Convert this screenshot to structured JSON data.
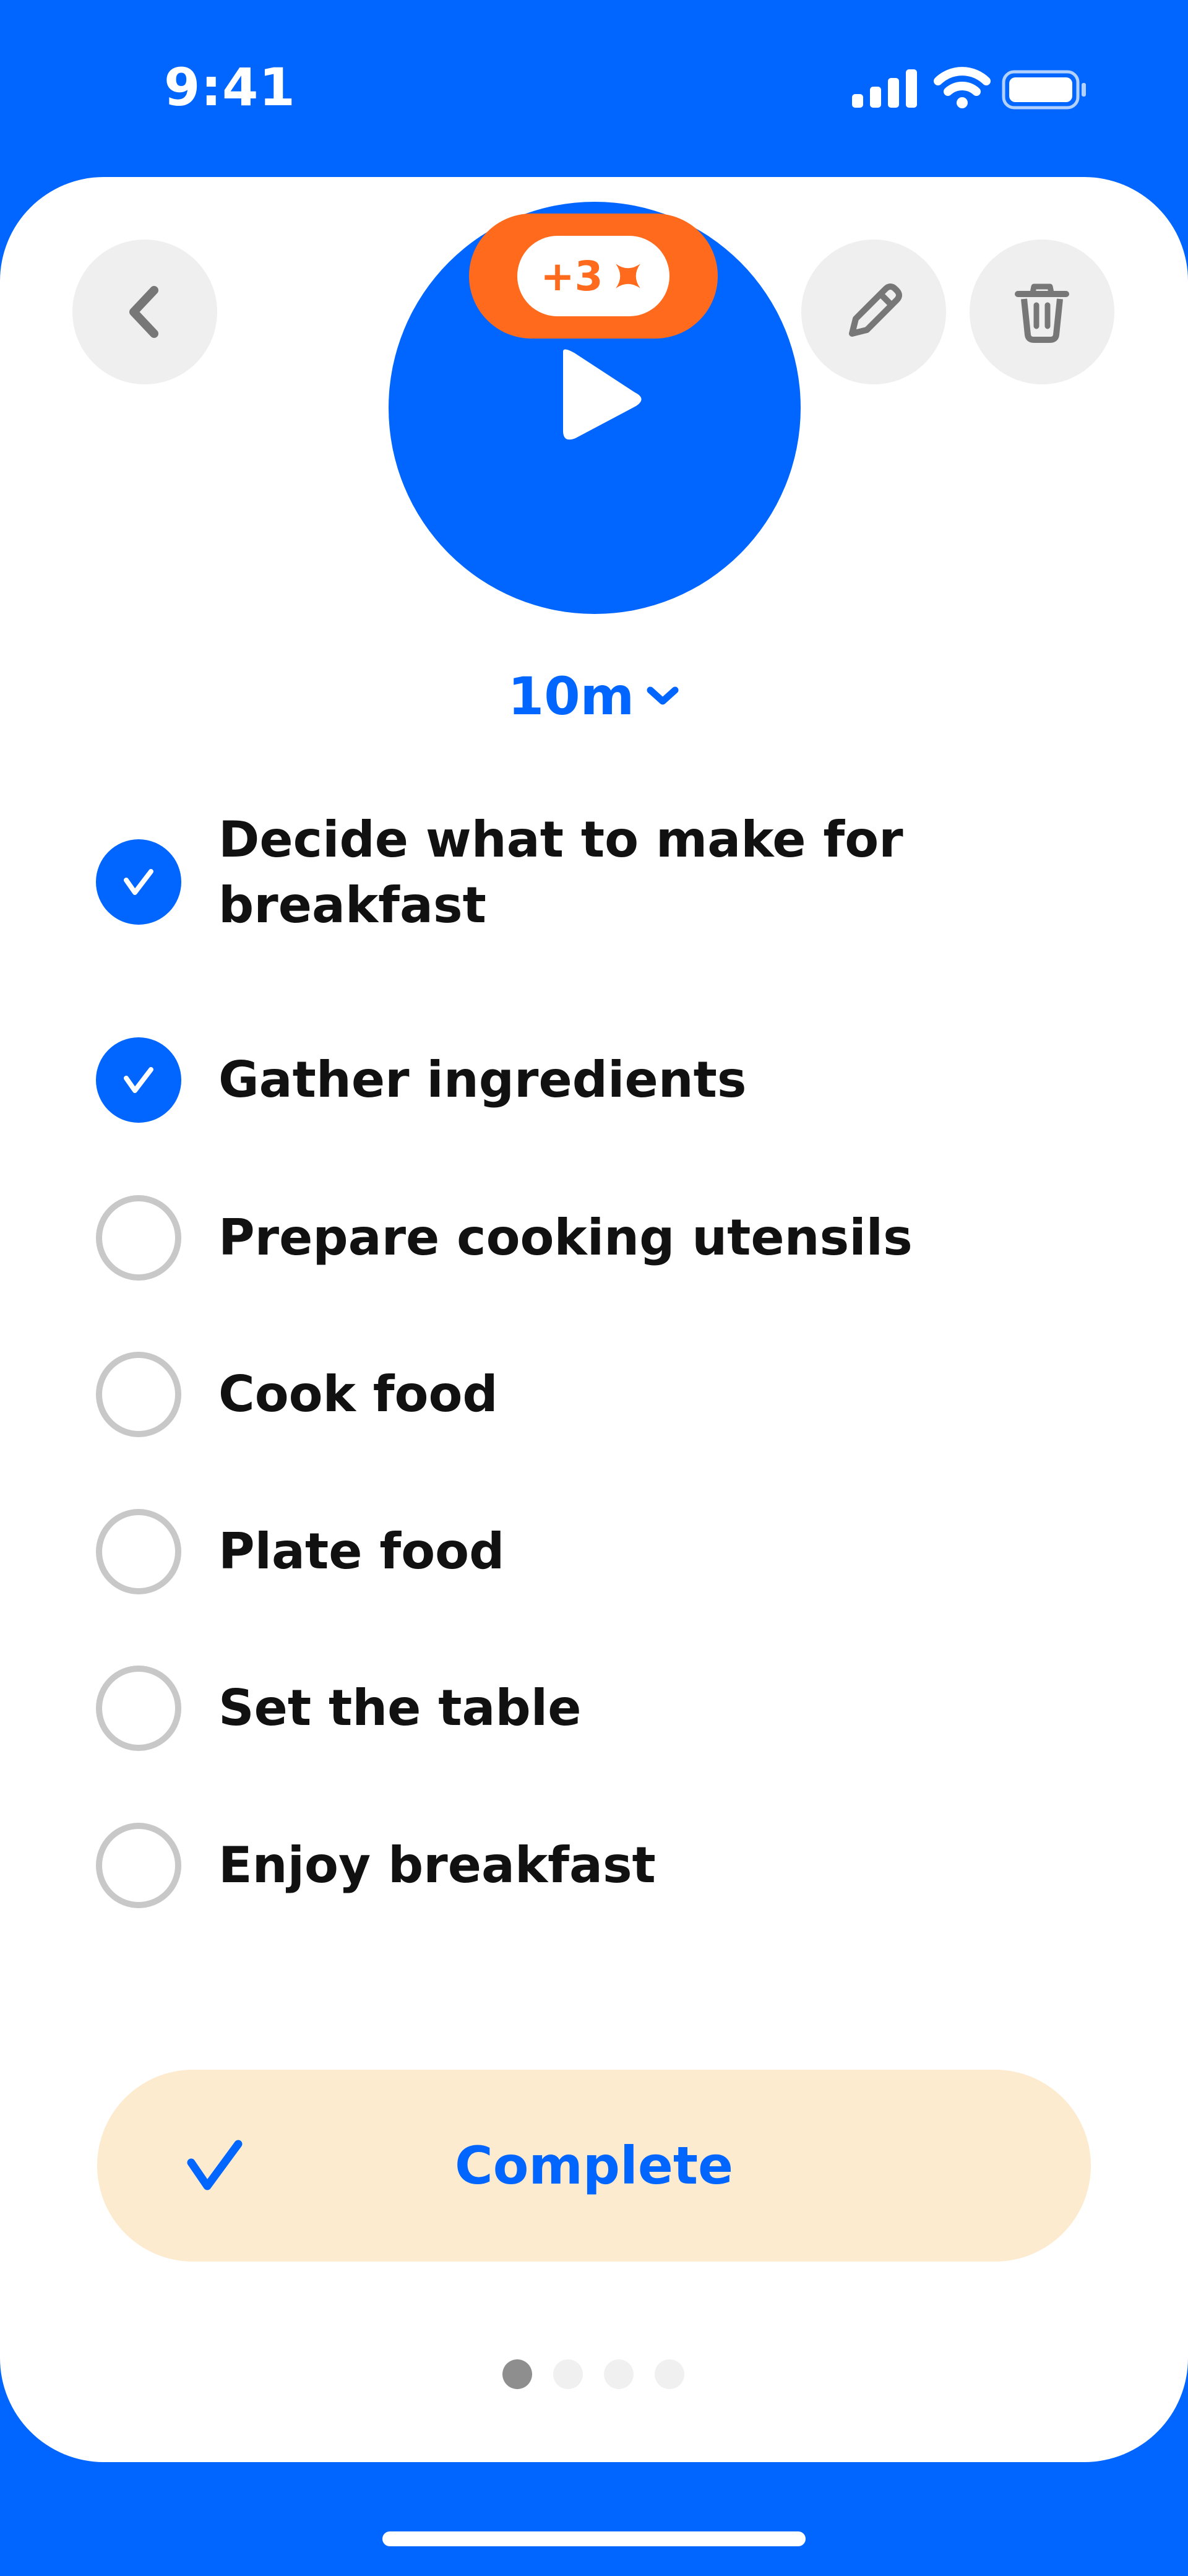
{
  "status_bar": {
    "time": "9:41"
  },
  "header": {
    "back_icon": "chevron-left-icon",
    "edit_icon": "pencil-icon",
    "delete_icon": "trash-icon"
  },
  "hero": {
    "icon": "play-icon",
    "reward": "+3",
    "reward_icon": "sparkle-icon",
    "duration": "10m",
    "duration_icon": "chevron-down-icon"
  },
  "tasks": [
    {
      "label": "Decide what to make for breakfast",
      "done": true
    },
    {
      "label": "Gather ingredients",
      "done": true
    },
    {
      "label": "Prepare cooking utensils",
      "done": false
    },
    {
      "label": "Cook food",
      "done": false
    },
    {
      "label": "Plate food",
      "done": false
    },
    {
      "label": "Set the table",
      "done": false
    },
    {
      "label": "Enjoy breakfast",
      "done": false
    }
  ],
  "complete_button": {
    "label": "Complete",
    "icon": "checkmark-icon"
  },
  "pager": {
    "pages": 4,
    "current": 1
  },
  "colors": {
    "accent": "#0066FF",
    "reward": "#FF6A1C",
    "complete_bg": "#FDEBD0",
    "unchecked_border": "#C8C8C8"
  }
}
